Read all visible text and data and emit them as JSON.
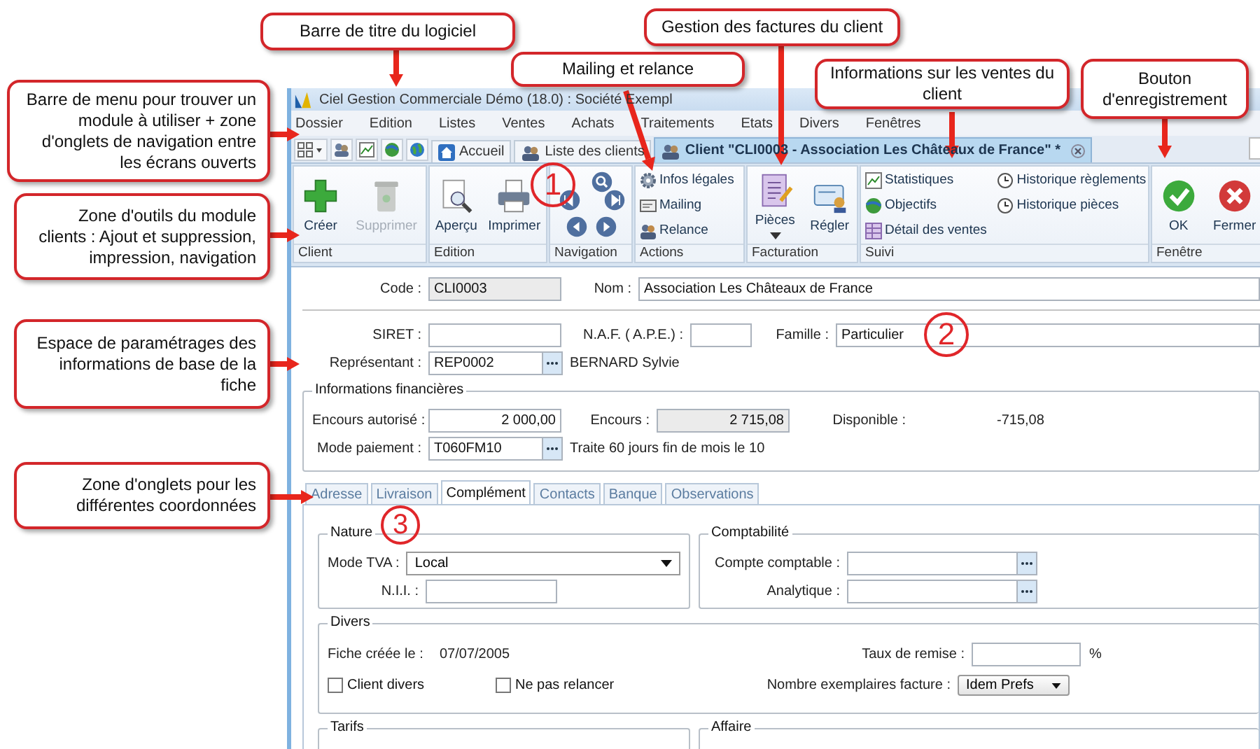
{
  "callouts": [
    {
      "text": "Barre de titre du logiciel"
    },
    {
      "text": "Mailing et relance"
    },
    {
      "text": "Gestion des factures du client"
    },
    {
      "text": "Informations sur les ventes du client"
    },
    {
      "text": "Bouton d'enregistrement"
    },
    {
      "text": "Barre de menu pour trouver un module à utiliser + zone d'onglets de navigation entre les écrans ouverts"
    },
    {
      "text": "Zone d'outils du module clients : Ajout et suppression, impression, navigation"
    },
    {
      "text": "Espace de paramétrages des informations de base de la fiche"
    },
    {
      "text": "Zone d'onglets pour les différentes coordonnées"
    }
  ],
  "markers": [
    "1",
    "2",
    "3"
  ],
  "window": {
    "title": "Ciel Gestion Commerciale Démo (18.0) : Société Exempl"
  },
  "menu": [
    "Dossier",
    "Edition",
    "Listes",
    "Ventes",
    "Achats",
    "Traitements",
    "Etats",
    "Divers",
    "Fenêtres"
  ],
  "nav_tabs": [
    {
      "label": "Accueil",
      "selected": false,
      "closable": false
    },
    {
      "label": "Liste des clients",
      "selected": false,
      "closable": false
    },
    {
      "label": "Client \"CLI0003 - Association Les Châteaux de France\" *",
      "selected": true,
      "closable": true
    }
  ],
  "ribbon": [
    {
      "label": "Client",
      "kind": "large",
      "buttons": [
        {
          "label": "Créer",
          "disabled": false,
          "dropdown": false
        },
        {
          "label": "Supprimer",
          "disabled": true,
          "dropdown": false
        }
      ]
    },
    {
      "label": "Edition",
      "kind": "large",
      "buttons": [
        {
          "label": "Aperçu",
          "disabled": false,
          "dropdown": false
        },
        {
          "label": "Imprimer",
          "disabled": false,
          "dropdown": false
        }
      ]
    },
    {
      "label": "Navigation",
      "kind": "nav"
    },
    {
      "label": "Actions",
      "kind": "list",
      "buttons": [
        {
          "label": "Infos légales"
        },
        {
          "label": "Mailing"
        },
        {
          "label": "Relance"
        }
      ]
    },
    {
      "label": "Facturation",
      "kind": "large",
      "buttons": [
        {
          "label": "Pièces",
          "disabled": false,
          "dropdown": true
        },
        {
          "label": "Régler",
          "disabled": false,
          "dropdown": false
        }
      ]
    },
    {
      "label": "Suivi",
      "kind": "list",
      "buttons": [
        {
          "label": "Statistiques"
        },
        {
          "label": "Objectifs"
        },
        {
          "label": "Détail des ventes"
        },
        {
          "label": "Historique règlements"
        },
        {
          "label": "Historique pièces"
        }
      ]
    },
    {
      "label": "Fenêtre",
      "kind": "large",
      "buttons": [
        {
          "label": "OK",
          "disabled": false,
          "dropdown": false
        },
        {
          "label": "Fermer",
          "disabled": false,
          "dropdown": false
        }
      ]
    }
  ],
  "form": {
    "code": {
      "label": "Code :",
      "value": "CLI0003"
    },
    "nom": {
      "label": "Nom :",
      "value": "Association Les Châteaux de France"
    },
    "siret": {
      "label": "SIRET :"
    },
    "naf": {
      "label": "N.A.F. ( A.P.E.) :"
    },
    "famille": {
      "label": "Famille :",
      "value": "Particulier"
    },
    "representant": {
      "label": "Représentant :",
      "value": "REP0002",
      "name": "BERNARD Sylvie"
    },
    "finances": {
      "title": "Informations financières",
      "encours_autorise": {
        "label": "Encours autorisé :",
        "value": "2 000,00"
      },
      "encours": {
        "label": "Encours :",
        "value": "2 715,08"
      },
      "disponible": {
        "label": "Disponible :",
        "value": "-715,08"
      },
      "mode_paiement": {
        "label": "Mode paiement :",
        "value": "T060FM10",
        "description": "Traite 60 jours fin de mois le 10"
      }
    }
  },
  "tabs": [
    {
      "label": "Adresse",
      "selected": false
    },
    {
      "label": "Livraison",
      "selected": false
    },
    {
      "label": "Complément",
      "selected": true
    },
    {
      "label": "Contacts",
      "selected": false
    },
    {
      "label": "Banque",
      "selected": false
    },
    {
      "label": "Observations",
      "selected": false
    }
  ],
  "nature": {
    "title": "Nature",
    "mode_tva": {
      "label": "Mode TVA :",
      "value": "Local"
    },
    "nii": {
      "label": "N.I.I. :"
    }
  },
  "comptabilite": {
    "title": "Comptabilité",
    "compte": {
      "label": "Compte comptable :"
    },
    "analytique": {
      "label": "Analytique :"
    }
  },
  "divers": {
    "title": "Divers",
    "fiche": {
      "label": "Fiche créée le :",
      "value": "07/07/2005"
    },
    "remise": {
      "label": "Taux de remise :",
      "unit": "%"
    },
    "client_divers": {
      "label": "Client divers",
      "checked": false
    },
    "ne_pas_relancer": {
      "label": "Ne pas relancer",
      "checked": false
    },
    "exemplaires": {
      "label": "Nombre exemplaires facture :",
      "value": "Idem Prefs"
    }
  },
  "bottom_groups": [
    "Tarifs",
    "Affaire"
  ]
}
